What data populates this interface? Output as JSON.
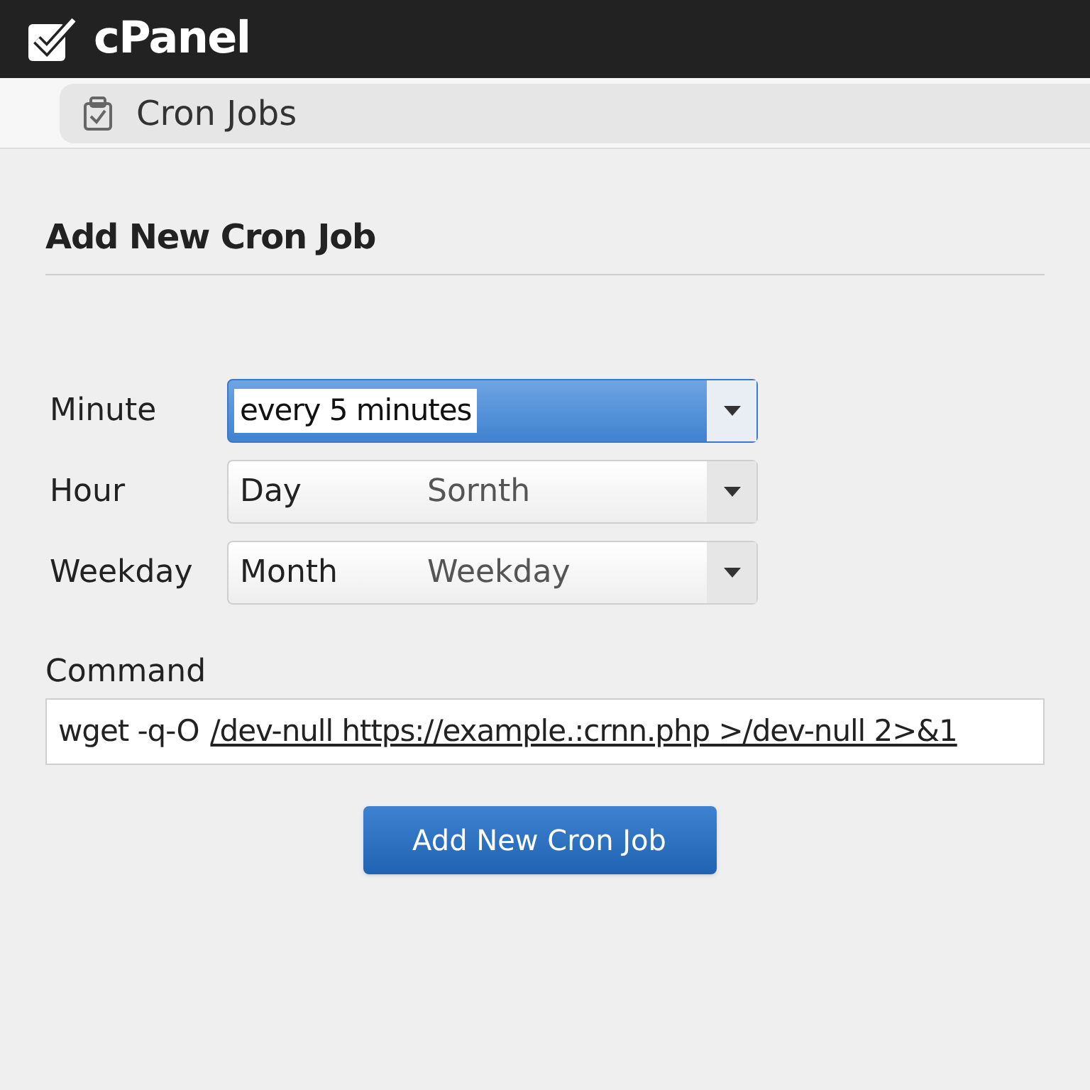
{
  "header": {
    "brand": "cPanel"
  },
  "breadcrumb": {
    "label": "Cron Jobs"
  },
  "form": {
    "title": "Add New Cron Job",
    "rows": [
      {
        "label": "Minute",
        "value": "every 5 minutes",
        "focused": true
      },
      {
        "label": "Hour",
        "value": "Day",
        "hint": "Sornth",
        "focused": false
      },
      {
        "label": "Weekday",
        "value": "Month",
        "hint": "Weekday",
        "focused": false
      }
    ],
    "command": {
      "label": "Command",
      "value_plain": "wget -q-O",
      "value_underlined": "/dev-null https://example.:crnn.php >/dev-null 2>&1"
    },
    "submit": "Add New Cron Job"
  }
}
